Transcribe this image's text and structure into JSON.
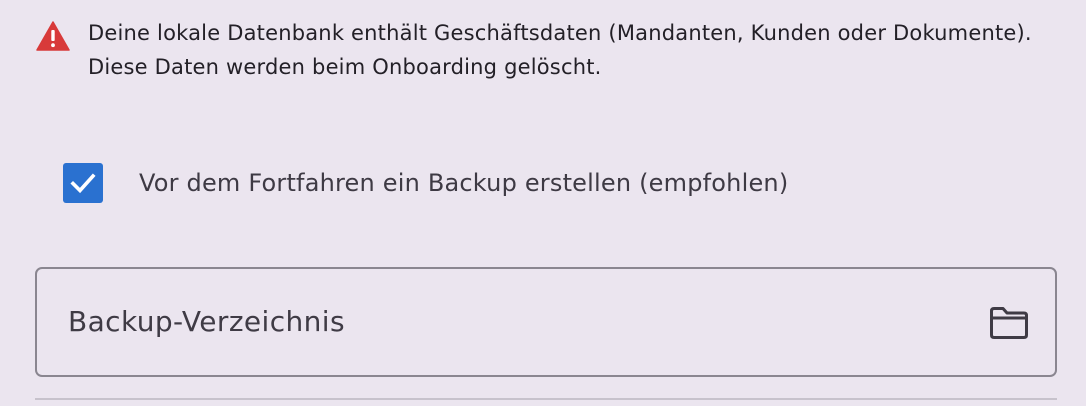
{
  "warning": {
    "icon": "warning-triangle-icon",
    "icon_color": "#d83a3a",
    "text": "Deine lokale Datenbank enthält Geschäftsdaten (Mandanten, Kunden oder Dokumente). Diese Daten werden beim Onboarding gelöscht."
  },
  "backup_checkbox": {
    "checked": true,
    "color": "#2a71d0",
    "label": "Vor dem Fortfahren ein Backup erstellen (empfohlen)"
  },
  "backup_directory": {
    "label": "Backup-Verzeichnis",
    "icon": "folder-icon"
  }
}
